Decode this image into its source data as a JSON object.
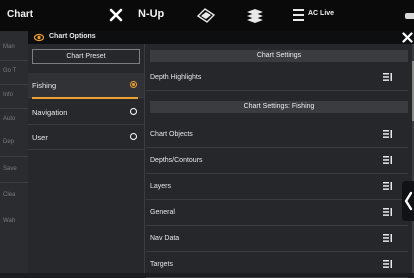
{
  "topbar": {
    "chart_label": "Chart",
    "nup_label": "N-Up",
    "aclive_label": "AC Live"
  },
  "background_sidebar": {
    "items": [
      "Man",
      "Go T",
      "Info",
      "Auto",
      "Dep",
      "Save",
      "Clea",
      "Wah"
    ]
  },
  "panel": {
    "title": "Chart Options",
    "preset_header": "Chart Preset",
    "presets": [
      {
        "label": "Fishing",
        "selected": true
      },
      {
        "label": "Navigation",
        "selected": false
      },
      {
        "label": "User",
        "selected": false
      }
    ],
    "chart_settings_header": "Chart Settings",
    "chart_settings_items": [
      "Depth Highlights"
    ],
    "fishing_header": "Chart Settings: Fishing",
    "fishing_items": [
      "Chart Objects",
      "Depths/Contours",
      "Layers",
      "General",
      "Nav Data",
      "Targets"
    ]
  },
  "colors": {
    "accent": "#f0a030",
    "panel_bg": "#25272a",
    "header_bg": "#0d0e10"
  },
  "icons": {
    "close": "close-icon",
    "chart_options": "eye-chart-icon",
    "row_menu": "menu-lines-icon"
  }
}
